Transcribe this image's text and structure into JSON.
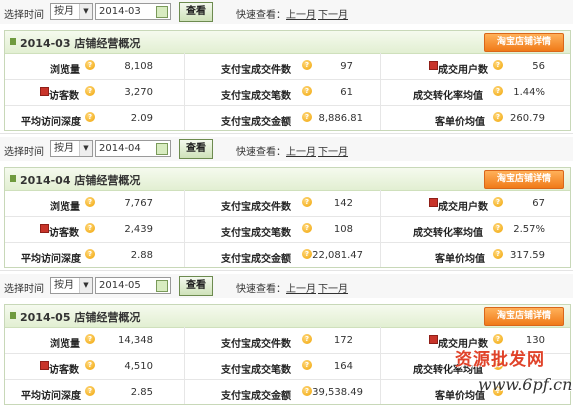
{
  "filter": {
    "select_time_label": "选择时间",
    "period_value": "按月",
    "query_button": "查看",
    "quick_view_label": "快速查看：",
    "prev_month": "上一月",
    "next_month": "下一月"
  },
  "panel": {
    "detail_button": "淘宝店铺详情"
  },
  "labels": {
    "views": "浏览量",
    "paid_items": "支付宝成交件数",
    "buyers": "成交用户数",
    "visitors": "访客数",
    "paid_orders": "支付宝成交笔数",
    "conversion_rate": "成交转化率均值",
    "avg_depth": "平均访问深度",
    "paid_amount": "支付宝成交金额",
    "avg_order_value": "客单价均值"
  },
  "months": [
    {
      "date": "2014-03",
      "title": "2014-03 店铺经营概况",
      "views": "8,108",
      "paid_items": "97",
      "buyers": "56",
      "visitors": "3,270",
      "paid_orders": "61",
      "conversion_rate": "1.44%",
      "avg_depth": "2.09",
      "paid_amount": "8,886.81",
      "avg_order_value": "260.79"
    },
    {
      "date": "2014-04",
      "title": "2014-04 店铺经营概况",
      "views": "7,767",
      "paid_items": "142",
      "buyers": "67",
      "visitors": "2,439",
      "paid_orders": "108",
      "conversion_rate": "2.57%",
      "avg_depth": "2.88",
      "paid_amount": "22,081.47",
      "avg_order_value": "317.59"
    },
    {
      "date": "2014-05",
      "title": "2014-05 店铺经营概况",
      "views": "14,348",
      "paid_items": "172",
      "buyers": "130",
      "visitors": "4,510",
      "paid_orders": "164",
      "conversion_rate": "",
      "avg_depth": "2.85",
      "paid_amount": "39,538.49",
      "avg_order_value": ""
    }
  ],
  "watermark": {
    "line1": "资源批发网",
    "line2": "www.6pf.cn"
  },
  "colors": {
    "panel_header": "#e2efd2",
    "detail_button": "#f07a18",
    "accent_green": "#6f9a3e"
  }
}
